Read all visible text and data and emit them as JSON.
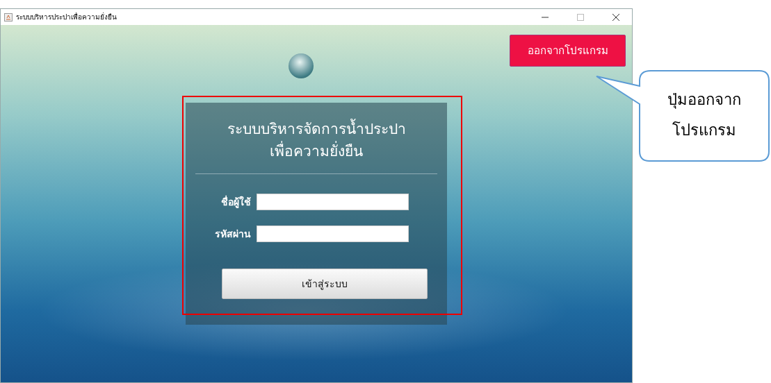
{
  "window": {
    "title": "ระบบบริหารประปาเพื่อความยั่งยืน"
  },
  "exit_button": {
    "label": "ออกจากโปรแกรม"
  },
  "login": {
    "title_lines": [
      "ระบบบริหารจัดการน้ำประปา",
      "เพื่อความยั่งยืน"
    ],
    "fields": [
      {
        "label": "ชื่อผู้ใช้"
      },
      {
        "label": "รหัสผ่าน"
      }
    ],
    "button": "เข้าสู่ระบบ"
  },
  "annotation": {
    "text_lines": [
      "ปุ่มออกจาก",
      "โปรแกรม"
    ]
  }
}
